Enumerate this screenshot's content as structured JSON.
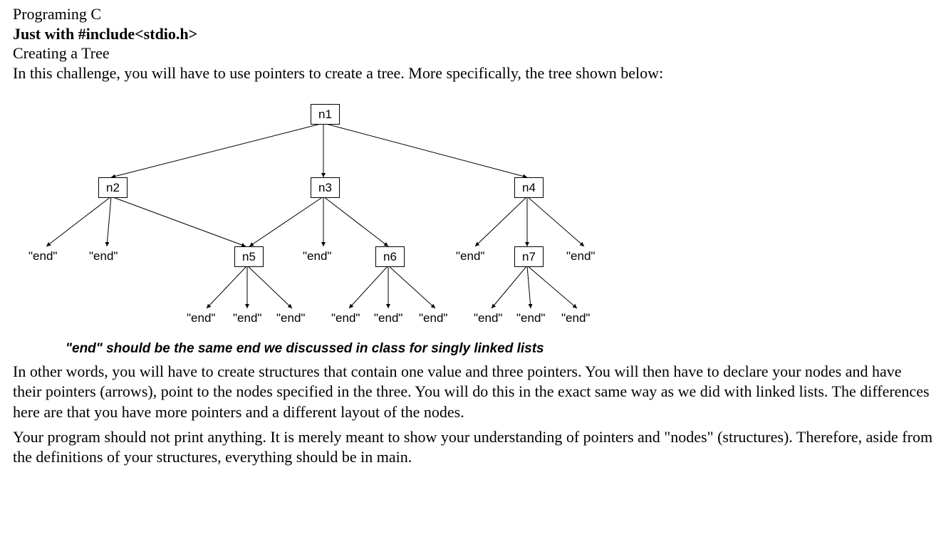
{
  "header": {
    "line1": "Programing C",
    "line2": "Just with #include<stdio.h>",
    "line3": "Creating a Tree",
    "line4": "In this challenge, you will have to use pointers to create a tree. More specifically, the tree shown below:"
  },
  "nodes": {
    "n1": "n1",
    "n2": "n2",
    "n3": "n3",
    "n4": "n4",
    "n5": "n5",
    "n6": "n6",
    "n7": "n7"
  },
  "endlabel": "\"end\"",
  "note": "\"end\" should be the same end we discussed in class for singly linked lists",
  "para1": "In other words, you will have to create structures that contain one value and three pointers. You will then have to declare your nodes and have their pointers (arrows), point to the nodes specified in the three. You will do this in the exact same way as we did with linked lists. The differences here are that you have more pointers and a different layout of the nodes.",
  "para2": "Your program should not print anything. It is merely meant to show your understanding of pointers and \"nodes\" (structures). Therefore, aside from the definitions of your structures, everything should be in main."
}
